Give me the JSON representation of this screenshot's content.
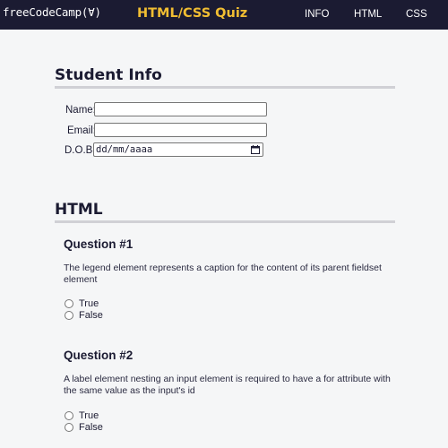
{
  "header": {
    "logo": "freeCodeCamp(Ɐ)",
    "title": "HTML/CSS Quiz",
    "nav": [
      "INFO",
      "HTML",
      "CSS"
    ]
  },
  "student_info": {
    "heading": "Student Info",
    "name_label": "Name:",
    "name_value": "",
    "email_label": "Email:",
    "email_value": "",
    "dob_label": "D.O.B.",
    "dob_placeholder": "dd/mm/aaaa"
  },
  "html_section": {
    "heading": "HTML",
    "questions": [
      {
        "title": "Question #1",
        "text": "The legend element represents a caption for the content of its parent fieldset element",
        "options": [
          "True",
          "False"
        ]
      },
      {
        "title": "Question #2",
        "text": "A label element nesting an input element is required to have a for attribute with the same value as the input's id",
        "options": [
          "True",
          "False"
        ]
      }
    ]
  },
  "colors": {
    "header_bg": "#1b1b32",
    "title_accent": "#f1be32",
    "page_bg": "#f5f6f7"
  }
}
